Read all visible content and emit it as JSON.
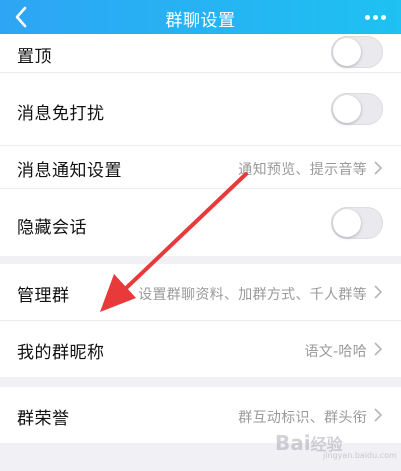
{
  "header": {
    "title": "群聊设置",
    "back_icon": "chevron-left-icon",
    "more_icon": "more-dots-icon",
    "color_start": "#2ea5f4",
    "color_end": "#1ec1f2"
  },
  "settings": {
    "pin": {
      "label": "置顶",
      "toggle_on": false
    },
    "do_not_disturb": {
      "label": "消息免打扰",
      "toggle_on": false
    },
    "notification": {
      "label": "消息通知设置",
      "value": "通知预览、提示音等"
    },
    "hide_chat": {
      "label": "隐藏会话",
      "toggle_on": false
    },
    "manage_group": {
      "label": "管理群",
      "value": "设置群聊资料、加群方式、千人群等"
    },
    "my_nickname": {
      "label": "我的群昵称",
      "value": "语文-哈哈"
    },
    "group_honor": {
      "label": "群荣誉",
      "value": "群互动标识、群头衔"
    }
  },
  "annotation": {
    "arrow_color": "#e83a3a"
  },
  "watermark": {
    "text": "Bai经验",
    "subtext": "jingyan.baidu.com"
  }
}
